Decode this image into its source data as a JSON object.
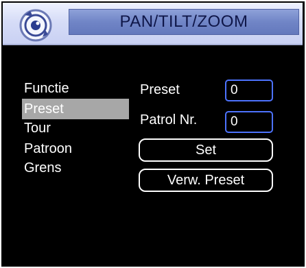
{
  "window": {
    "title": "PAN/TILT/ZOOM"
  },
  "menu": {
    "items": [
      {
        "label": "Functie"
      },
      {
        "label": "Preset"
      },
      {
        "label": "Tour"
      },
      {
        "label": "Patroon"
      },
      {
        "label": "Grens"
      }
    ],
    "selected": "Preset"
  },
  "form": {
    "preset_label": "Preset",
    "preset_value": "0",
    "patrol_label": "Patrol Nr.",
    "patrol_value": "0"
  },
  "buttons": {
    "set_label": "Set",
    "remove_preset_label": "Verw. Preset"
  },
  "colors": {
    "background": "#000000",
    "title_bar": "#d6dcf7",
    "title_plate": "#7085c6",
    "input_border": "#4d73ff",
    "selection": "#a7a7a7"
  },
  "icons": {
    "logo": "camera-ptz-icon"
  }
}
